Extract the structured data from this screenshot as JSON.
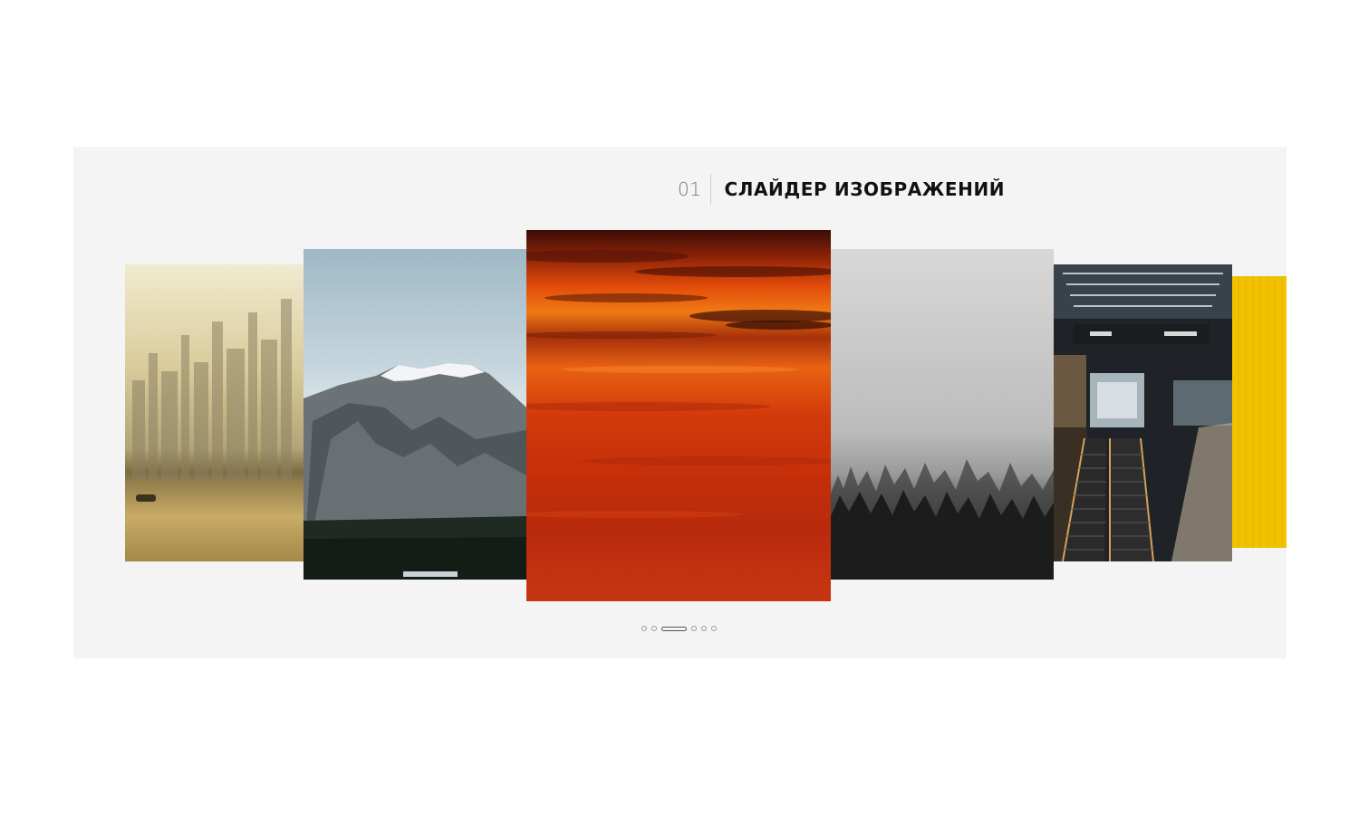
{
  "heading": {
    "number": "01",
    "title": "СЛАЙДЕР ИЗОБРАЖЕНИЙ"
  },
  "slider": {
    "slides": [
      {
        "name": "hazy-city-skyline"
      },
      {
        "name": "snowy-mountain"
      },
      {
        "name": "red-sunset-sky"
      },
      {
        "name": "misty-forest"
      },
      {
        "name": "station-escalators"
      },
      {
        "name": "yellow-wall"
      }
    ],
    "active_slide_index": 2,
    "dot_count": 6
  }
}
